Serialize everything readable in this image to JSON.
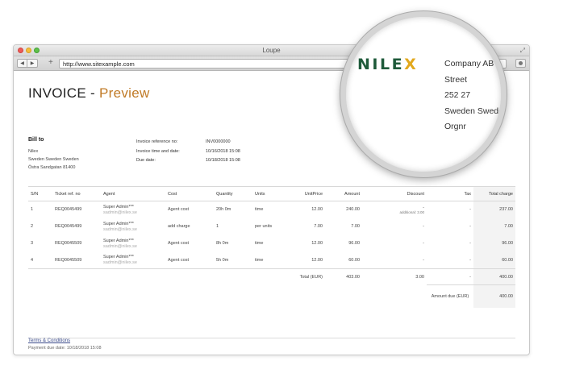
{
  "window": {
    "title": "Loupe",
    "url": "http://www.sitexample.com"
  },
  "invoice": {
    "title_main": "INVOICE - ",
    "title_accent": "Preview"
  },
  "bill_to": {
    "heading": "Bill to",
    "lines": [
      "Nilex",
      "Sweden Sweden Sweden",
      "Östra Sandgatan 81400"
    ]
  },
  "meta": [
    {
      "label": "Invoice reference no:",
      "value": "INV0000000"
    },
    {
      "label": "Invoice time and date:",
      "value": "10/16/2018 15:08"
    },
    {
      "label": "Due date:",
      "value": "10/18/2018 15:08"
    }
  ],
  "table": {
    "headers": [
      "S/N",
      "Ticket ref. no",
      "Agent",
      "Cost",
      "Quantity",
      "Units",
      "UnitPrice",
      "Amount",
      "Discount",
      "Tax",
      "Total charge"
    ],
    "rows": [
      {
        "sn": "1",
        "ticket": "REQ0045499",
        "agent": "Super Admin***",
        "email": "sadmin@nilex.se",
        "cost": "Agent cost",
        "qty": "20h 0m",
        "units": "time",
        "unit_price": "12.00",
        "amount": "240.00",
        "discount": "-",
        "discount_note": "additional: 3.00",
        "tax": "-",
        "total": "237.00"
      },
      {
        "sn": "2",
        "ticket": "REQ0045499",
        "agent": "Super Admin***",
        "email": "sadmin@nilex.se",
        "cost": "add charge",
        "qty": "1",
        "units": "per units",
        "unit_price": "7.00",
        "amount": "7.00",
        "discount": "-",
        "discount_note": "",
        "tax": "-",
        "total": "7.00"
      },
      {
        "sn": "3",
        "ticket": "REQ0045509",
        "agent": "Super Admin***",
        "email": "sadmin@nilex.se",
        "cost": "Agent cost",
        "qty": "8h 0m",
        "units": "time",
        "unit_price": "12.00",
        "amount": "96.00",
        "discount": "-",
        "discount_note": "",
        "tax": "-",
        "total": "96.00"
      },
      {
        "sn": "4",
        "ticket": "REQ0045509",
        "agent": "Super Admin***",
        "email": "sadmin@nilex.se",
        "cost": "Agent cost",
        "qty": "5h 0m",
        "units": "time",
        "unit_price": "12.00",
        "amount": "60.00",
        "discount": "-",
        "discount_note": "",
        "tax": "-",
        "total": "60.00"
      }
    ],
    "total": {
      "label": "Total (EUR)",
      "amount": "403.00",
      "discount": "3.00",
      "tax": "-",
      "total": "400.00"
    },
    "amount_due": {
      "label": "Amount due (EUR)",
      "value": "400.00"
    }
  },
  "footer": {
    "terms": "Terms & Conditions",
    "due_note": "Payment due date: 10/18/2018 15:08"
  },
  "loupe": {
    "logo_main": "NILE",
    "logo_accent": "X",
    "lines": [
      "Company AB",
      "Street",
      "252 27",
      "Sweden Sweden",
      "Orgnr"
    ]
  },
  "colors": {
    "accent": "#c07a26",
    "logo_green": "#1e5a3a",
    "logo_yellow": "#e2a81d"
  }
}
